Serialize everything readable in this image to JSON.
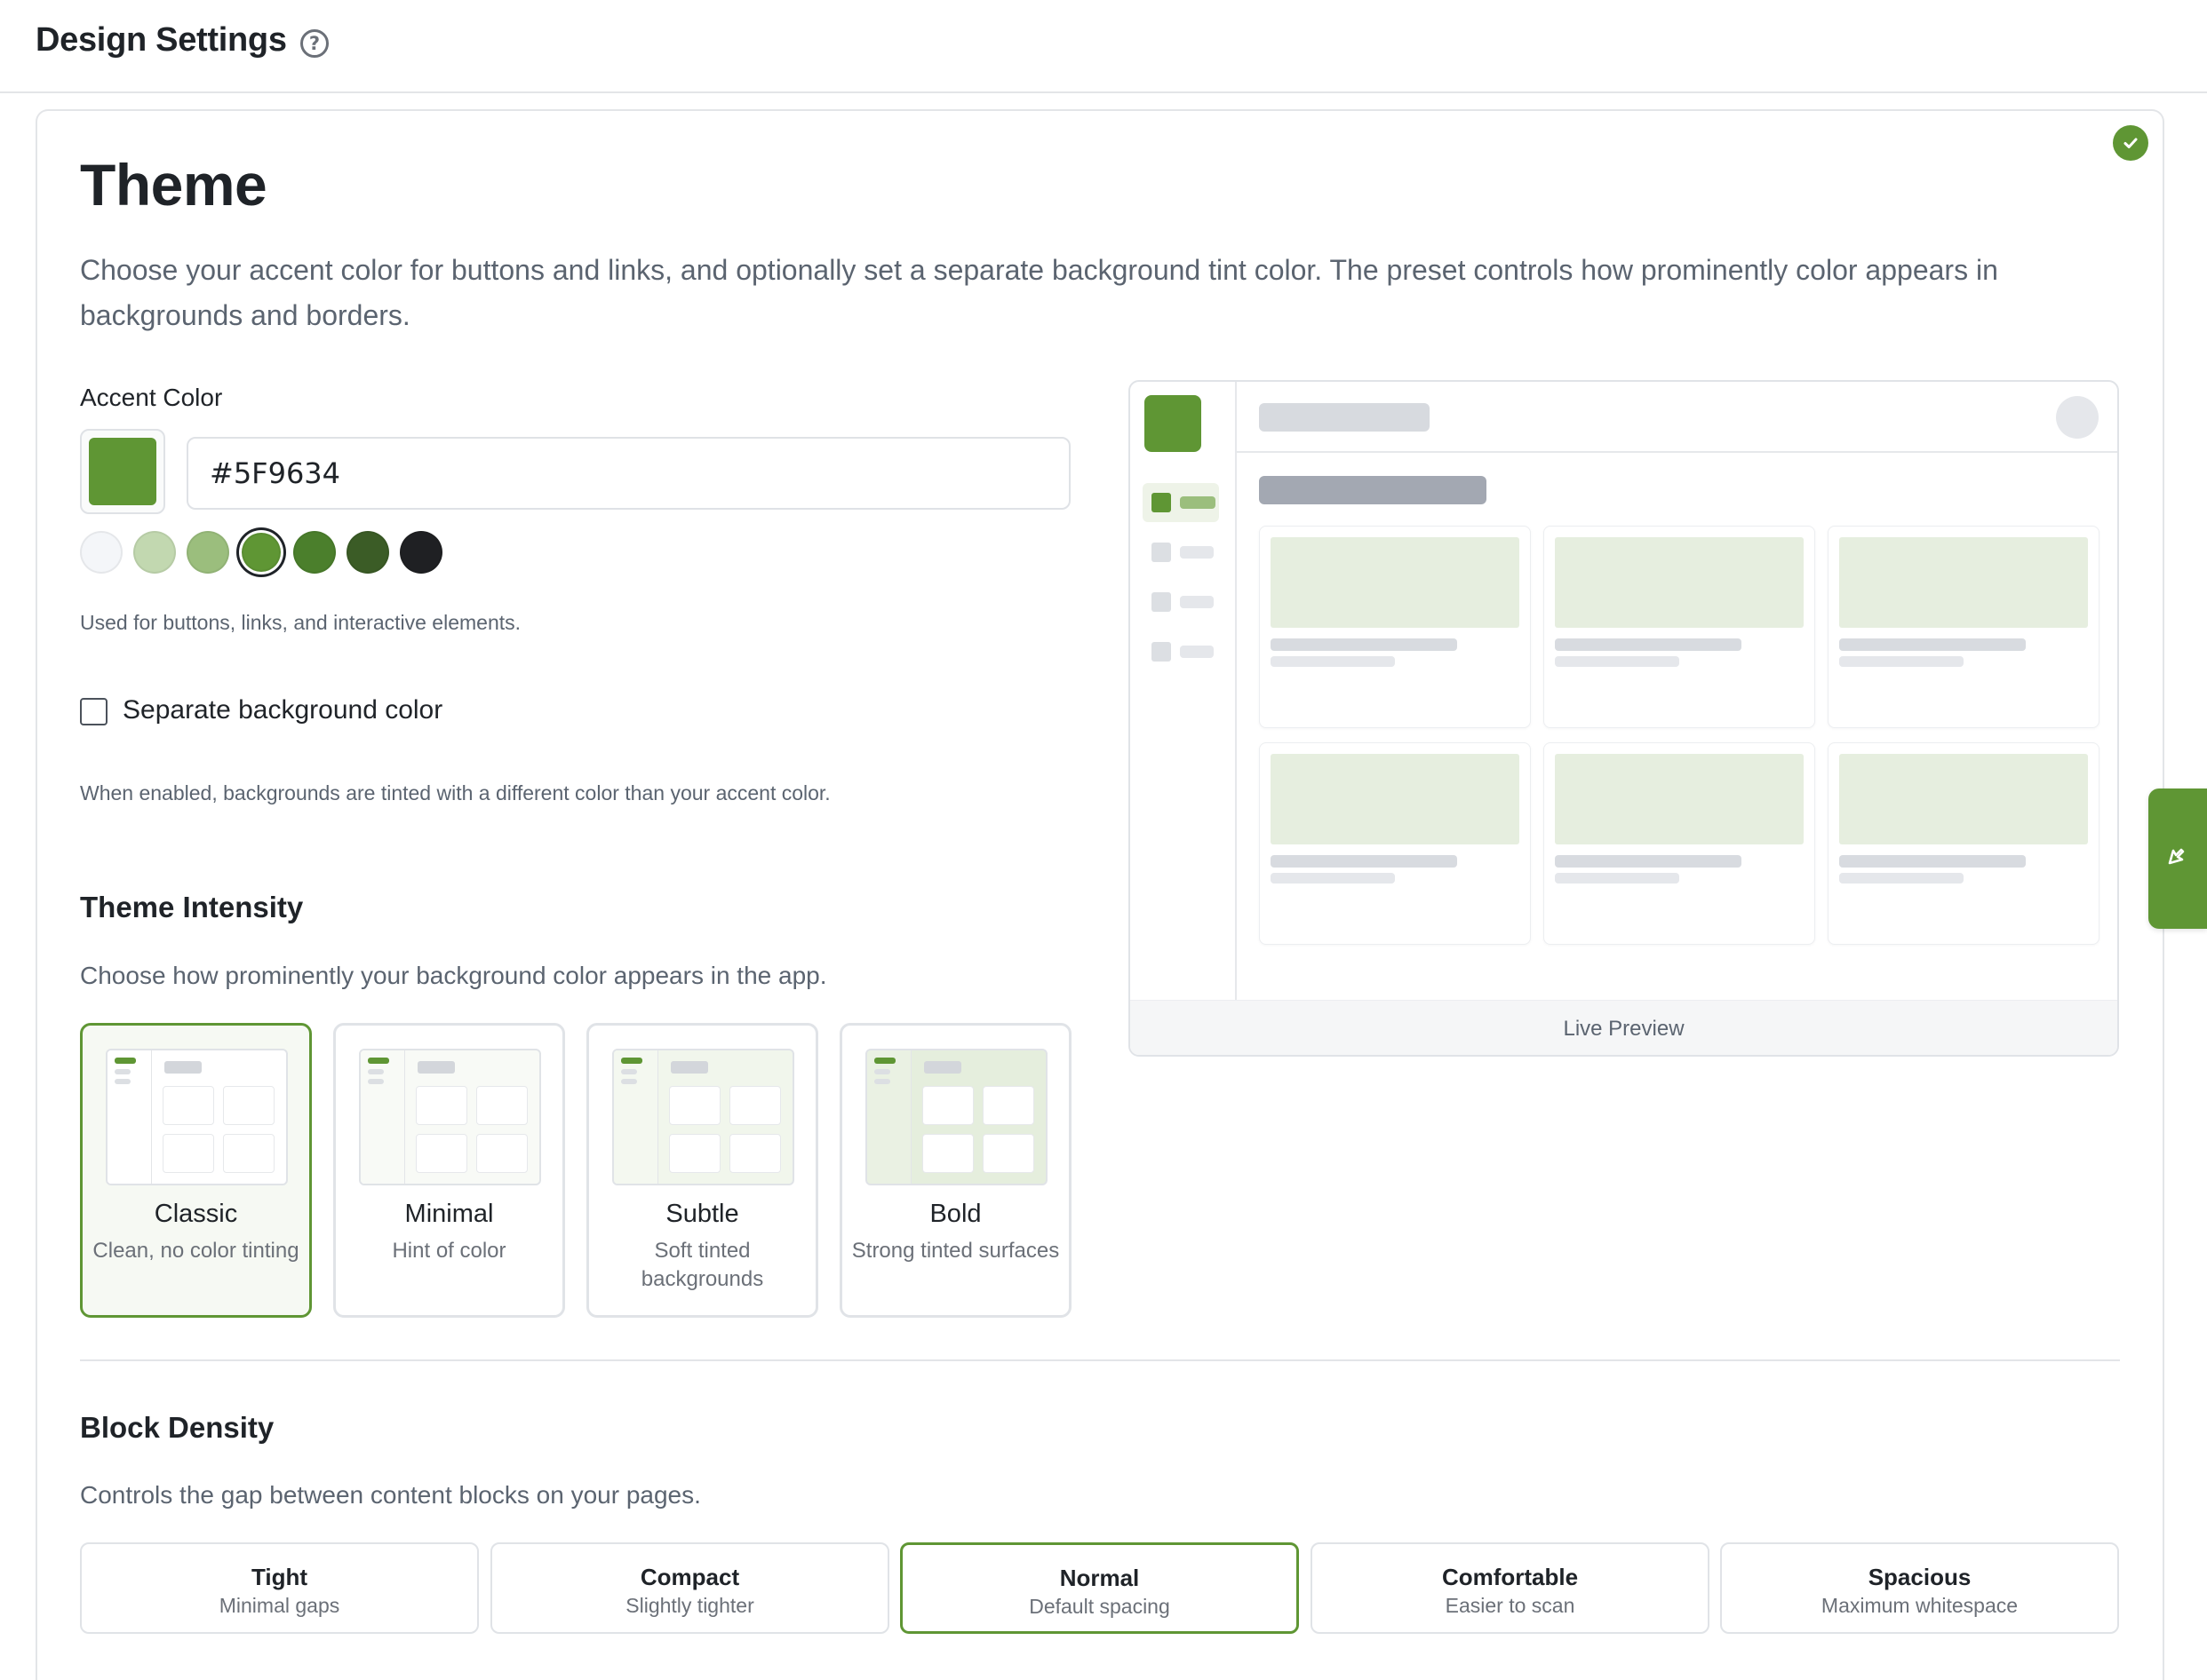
{
  "header": {
    "title": "Design Settings",
    "help_icon": "question-circle-icon"
  },
  "theme": {
    "title": "Theme",
    "description": "Choose your accent color for buttons and links, and optionally set a separate background tint color. The preset controls how prominently color appears in backgrounds and borders.",
    "saved_icon": "check-circle-icon",
    "accent": {
      "label": "Accent Color",
      "value": "#5F9634",
      "swatch_color": "#5F9634",
      "presets": [
        {
          "color": "#f4f6f9",
          "selected": false
        },
        {
          "color": "#c2d8b0",
          "selected": false
        },
        {
          "color": "#9bbe7d",
          "selected": false
        },
        {
          "color": "#5f9634",
          "selected": true
        },
        {
          "color": "#4b7f2c",
          "selected": false
        },
        {
          "color": "#3b5c26",
          "selected": false
        },
        {
          "color": "#1f2023",
          "selected": false
        }
      ],
      "hint": "Used for buttons, links, and interactive elements."
    },
    "background": {
      "checkbox_label": "Separate background color",
      "checked": false,
      "hint": "When enabled, backgrounds are tinted with a different color than your accent color."
    }
  },
  "intensity": {
    "title": "Theme Intensity",
    "description": "Choose how prominently your background color appears in the app.",
    "options": [
      {
        "name": "Classic",
        "description": "Clean, no color tinting",
        "selected": true,
        "tint": "#ffffff",
        "side_tint": "#ffffff"
      },
      {
        "name": "Minimal",
        "description": "Hint of color",
        "selected": false,
        "tint": "#f8faf6",
        "side_tint": "#f8faf6"
      },
      {
        "name": "Subtle",
        "description": "Soft tinted backgrounds",
        "selected": false,
        "tint": "#f1f6ec",
        "side_tint": "#f4f8f0"
      },
      {
        "name": "Bold",
        "description": "Strong tinted surfaces",
        "selected": false,
        "tint": "#e5eedd",
        "side_tint": "#eaf1e3"
      }
    ]
  },
  "density": {
    "title": "Block Density",
    "description": "Controls the gap between content blocks on your pages.",
    "options": [
      {
        "name": "Tight",
        "description": "Minimal gaps",
        "selected": false
      },
      {
        "name": "Compact",
        "description": "Slightly tighter",
        "selected": false
      },
      {
        "name": "Normal",
        "description": "Default spacing",
        "selected": true
      },
      {
        "name": "Comfortable",
        "description": "Easier to scan",
        "selected": false
      },
      {
        "name": "Spacious",
        "description": "Maximum whitespace",
        "selected": false
      }
    ]
  },
  "preview": {
    "label": "Live Preview"
  },
  "feedback_tab": {
    "icon": "cursor-pointer-icon"
  },
  "colors": {
    "accent": "#5F9634",
    "border": "#e0e3e7",
    "muted_text": "#5b6470"
  }
}
